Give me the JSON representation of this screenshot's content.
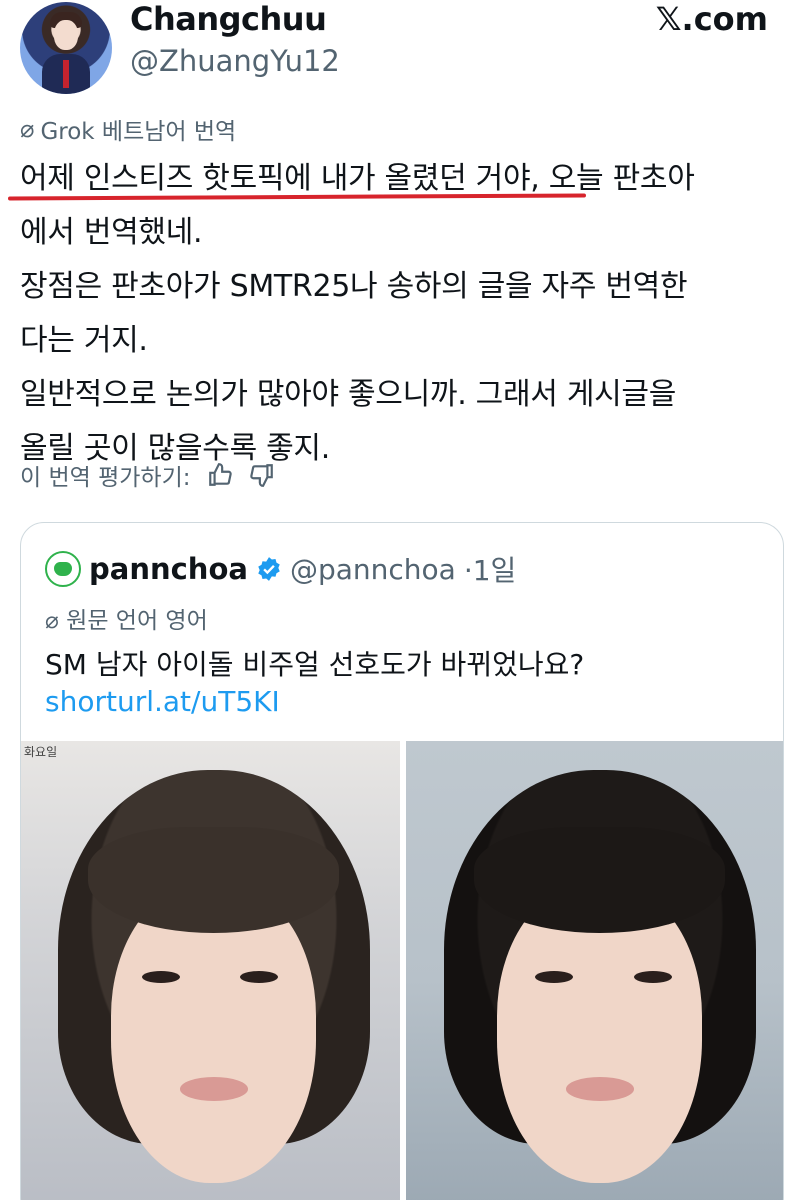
{
  "author": {
    "name": "Changchuu",
    "handle": "@ZhuangYu12"
  },
  "brand": "𝕏.com",
  "translation": {
    "label": "Grok 베트남어 번역",
    "lines": [
      "어제 인스티즈 핫토픽에 내가 올렸던 거야, 오늘 판초아",
      "에서 번역했네.",
      "장점은 판초아가 SMTR25나 송하의 글을 자주 번역한",
      "다는 거지.",
      "일반적으로 논의가 많아야 좋으니까. 그래서 게시글을",
      "올릴 곳이 많을수록 좋지."
    ],
    "rate_label": "이 번역 평가하기:"
  },
  "quote": {
    "name": "pannchoa",
    "handle": "@pannchoa",
    "time": "·1일",
    "original_language": "원문 언어 영어",
    "text": "SM 남자 아이돌 비주얼 선호도가 바뀌었나요?",
    "link": "shorturl.at/uT5KI",
    "photo_label": "화요일"
  },
  "colors": {
    "accent": "#1d9bf0",
    "underline": "#d7242c",
    "secondary_text": "#536471"
  },
  "icons": [
    "slash-icon",
    "thumbs-up-icon",
    "thumbs-down-icon",
    "verified-badge-icon"
  ]
}
